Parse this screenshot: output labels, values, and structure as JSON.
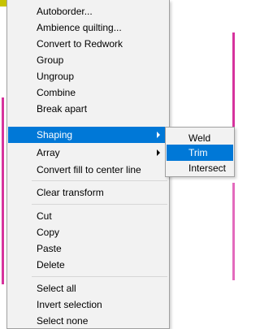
{
  "menu": {
    "items": [
      {
        "label": "Autoborder..."
      },
      {
        "label": "Ambience quilting..."
      },
      {
        "label": "Convert to Redwork"
      },
      {
        "label": "Group"
      },
      {
        "label": "Ungroup"
      },
      {
        "label": "Combine"
      },
      {
        "label": "Break apart"
      },
      {
        "label": "Shaping"
      },
      {
        "label": "Array"
      },
      {
        "label": "Convert fill to center line"
      },
      {
        "label": "Clear transform"
      },
      {
        "label": "Cut"
      },
      {
        "label": "Copy"
      },
      {
        "label": "Paste"
      },
      {
        "label": "Delete"
      },
      {
        "label": "Select all"
      },
      {
        "label": "Invert selection"
      },
      {
        "label": "Select none"
      }
    ]
  },
  "submenu": {
    "items": [
      {
        "label": "Weld"
      },
      {
        "label": "Trim"
      },
      {
        "label": "Intersect"
      }
    ]
  },
  "colors": {
    "highlight": "#0078d7",
    "menu_bg": "#f2f2f2"
  }
}
